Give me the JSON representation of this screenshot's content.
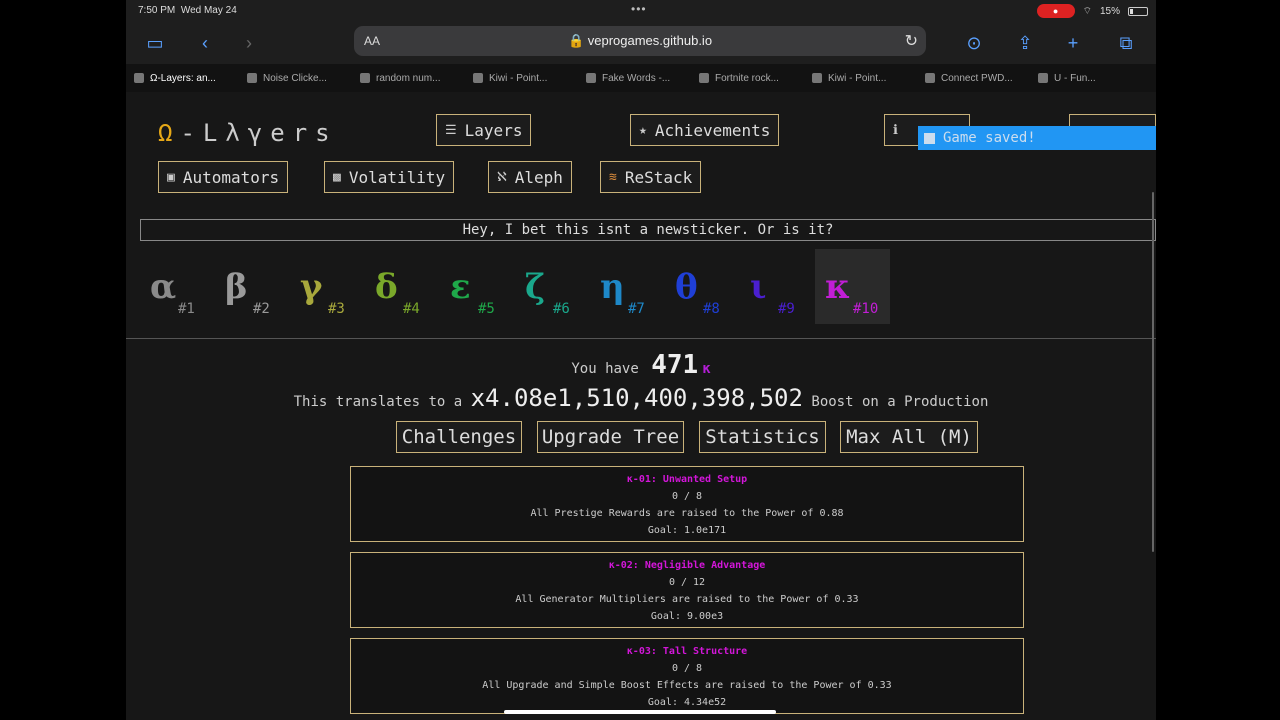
{
  "status_bar": {
    "time": "7:50 PM",
    "date": "Wed May 24",
    "battery": "15%"
  },
  "browser": {
    "aa_label": "AA",
    "url": "veprogames.github.io",
    "tabs": [
      {
        "title": "Ω-Layers: an...",
        "active": true
      },
      {
        "title": "Noise Clicke..."
      },
      {
        "title": "random num..."
      },
      {
        "title": "Kiwi - Point..."
      },
      {
        "title": "Fake Words -..."
      },
      {
        "title": "Fortnite rock..."
      },
      {
        "title": "Kiwi - Point..."
      },
      {
        "title": "Connect PWD..."
      },
      {
        "title": "U - Fun..."
      }
    ]
  },
  "game": {
    "title_omega": "Ω",
    "title_rest": "-Lλγers",
    "nav": {
      "layers": "Layers",
      "achievements": "Achievements",
      "automators": "Automators",
      "volatility": "Volatility",
      "aleph": "Aleph",
      "restack": "ReStack"
    },
    "toast": "Game saved!",
    "ticker": "Hey, I bet this isnt a newsticker. Or is it?",
    "layers": [
      {
        "symbol": "α",
        "number": "#1",
        "color": "#8a8a8a"
      },
      {
        "symbol": "β",
        "number": "#2",
        "color": "#9a9a9a"
      },
      {
        "symbol": "γ",
        "number": "#3",
        "color": "#a8a83c"
      },
      {
        "symbol": "δ",
        "number": "#4",
        "color": "#7aa82a"
      },
      {
        "symbol": "ε",
        "number": "#5",
        "color": "#1fa84a"
      },
      {
        "symbol": "ζ",
        "number": "#6",
        "color": "#1aa88c"
      },
      {
        "symbol": "η",
        "number": "#7",
        "color": "#1e88c8"
      },
      {
        "symbol": "θ",
        "number": "#8",
        "color": "#1f3fd6"
      },
      {
        "symbol": "ι",
        "number": "#9",
        "color": "#4a1fd0"
      },
      {
        "symbol": "κ",
        "number": "#10",
        "color": "#c21ed6",
        "selected": true
      }
    ],
    "you_have_prefix": "You have",
    "amount": "471",
    "amount_symbol": "κ",
    "boost_prefix": "This translates to a",
    "boost_value": "x4.08e1,510,400,398,502",
    "boost_suffix": "Boost on a Production",
    "tabs": {
      "challenges": "Challenges",
      "upgrade_tree": "Upgrade Tree",
      "statistics": "Statistics",
      "max_all": "Max All (M)"
    },
    "challenges": [
      {
        "title": "κ-01: Unwanted Setup",
        "progress": "0 / 8",
        "description": "All Prestige Rewards are raised to the Power of 0.88",
        "goal": "Goal: 1.0e171"
      },
      {
        "title": "κ-02: Negligible Advantage",
        "progress": "0 / 12",
        "description": "All Generator Multipliers are raised to the Power of 0.33",
        "goal": "Goal: 9.00e3"
      },
      {
        "title": "κ-03: Tall Structure",
        "progress": "0 / 8",
        "description": "All Upgrade and Simple Boost Effects are raised to the Power of 0.33",
        "goal": "Goal: 4.34e52"
      }
    ]
  }
}
